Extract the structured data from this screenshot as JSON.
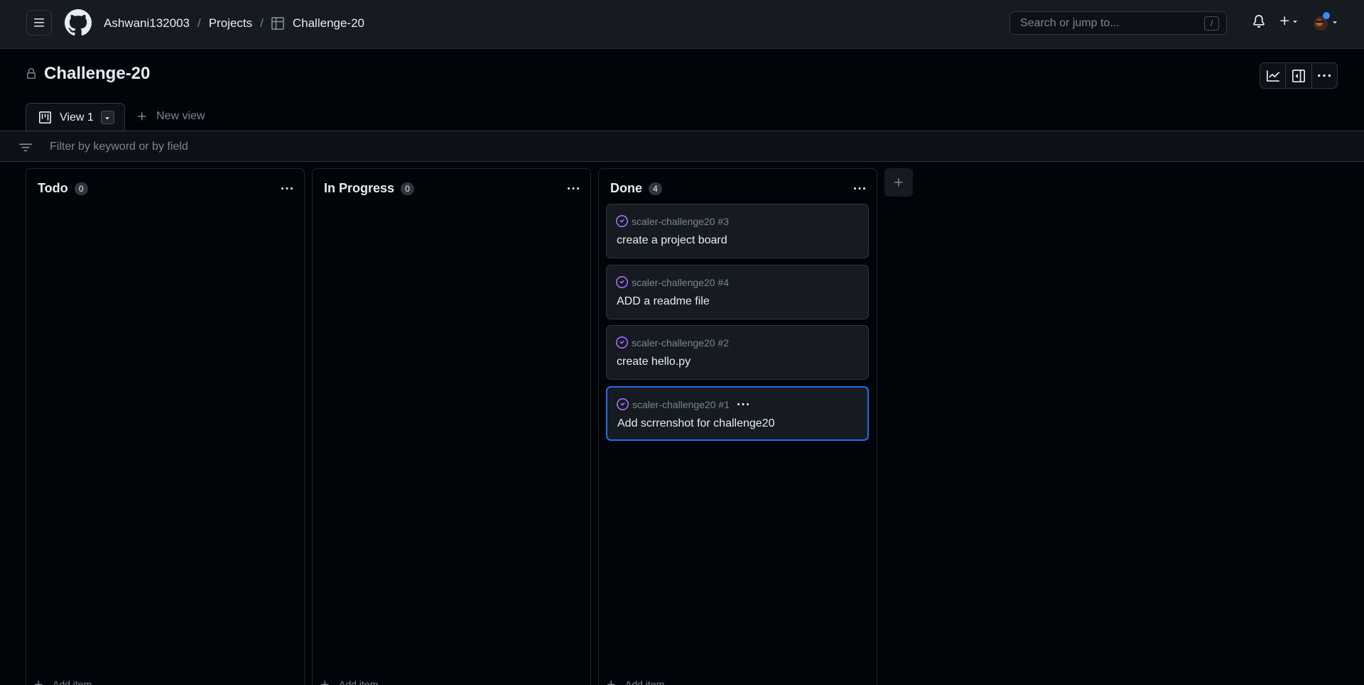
{
  "header": {
    "owner": "Ashwani132003",
    "projects": "Projects",
    "separator": "/",
    "project": "Challenge-20",
    "search_placeholder": "Search or jump to...",
    "search_shortcut": "/"
  },
  "title": {
    "name": "Challenge-20",
    "icons": [
      "lock-icon",
      "graph-icon",
      "sidebar-expand-icon",
      "kebab-horizontal-icon"
    ]
  },
  "tabs": {
    "active": "View 1",
    "new": "New view"
  },
  "filter": {
    "placeholder": "Filter by keyword or by field"
  },
  "columns": [
    {
      "title": "Todo",
      "count": "0",
      "add": "Add item",
      "cards": []
    },
    {
      "title": "In Progress",
      "count": "0",
      "add": "Add item",
      "cards": []
    },
    {
      "title": "Done",
      "count": "4",
      "add": "Add item",
      "cards": [
        {
          "ref": "scaler-challenge20 #3",
          "title": "create a project board"
        },
        {
          "ref": "scaler-challenge20 #4",
          "title": "ADD a readme file"
        },
        {
          "ref": "scaler-challenge20 #2",
          "title": "create hello.py"
        },
        {
          "ref": "scaler-challenge20 #1",
          "title": "Add scrrenshot for challenge20"
        }
      ]
    }
  ],
  "colors": {
    "background": "#010409",
    "surface": "#161b22",
    "border": "#30363d",
    "muted": "#7d8590",
    "accent": "#1f6feb",
    "done": "#a371f7"
  }
}
